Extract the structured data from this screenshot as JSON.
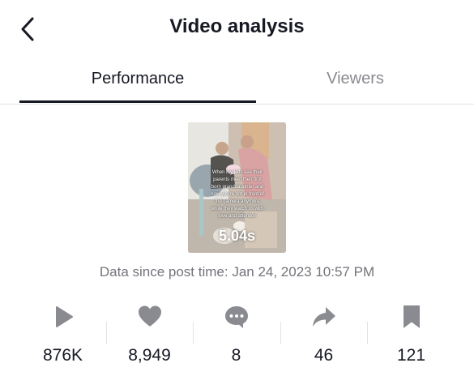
{
  "header": {
    "title": "Video analysis",
    "back_icon": "chevron-left-icon"
  },
  "tabs": [
    {
      "label": "Performance",
      "active": true
    },
    {
      "label": "Viewers",
      "active": false
    }
  ],
  "video": {
    "caption": "When my kids see their parents meet their first born granddaughter and now you're not in front of the camera anymore while they watch us with love and attention",
    "duration": "5.04s"
  },
  "data_since": "Data since post time: Jan 24, 2023 10:57 PM",
  "stats": [
    {
      "icon": "play-icon",
      "value": "876K"
    },
    {
      "icon": "heart-icon",
      "value": "8,949"
    },
    {
      "icon": "comment-icon",
      "value": "8"
    },
    {
      "icon": "share-icon",
      "value": "46"
    },
    {
      "icon": "bookmark-icon",
      "value": "121"
    }
  ],
  "colors": {
    "icon_gray": "#8a8b91",
    "text_primary": "#161823",
    "text_secondary": "#73747b"
  }
}
